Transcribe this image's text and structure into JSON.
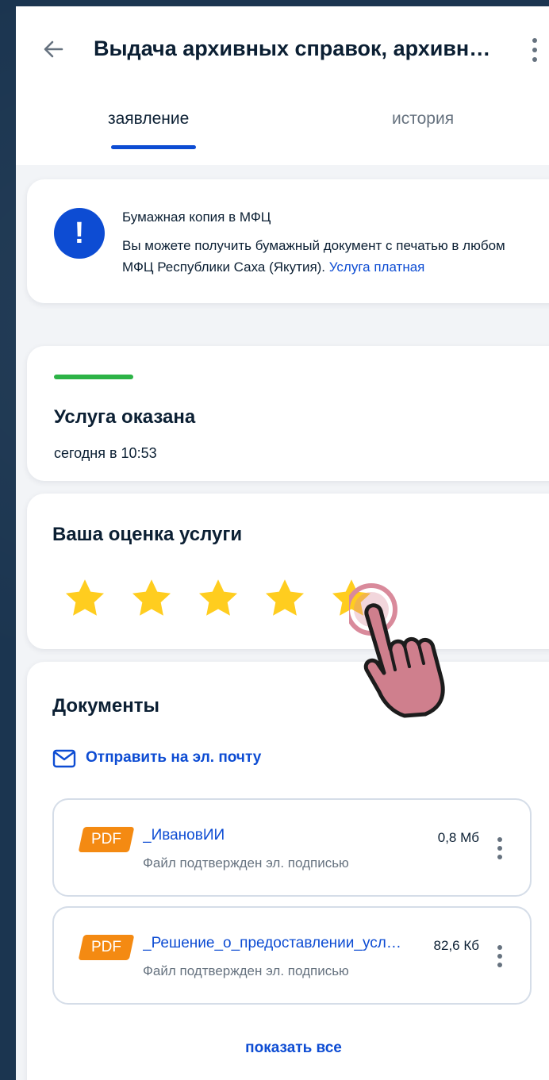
{
  "header": {
    "title": "Выдача архивных справок, архивных выписок и копий архивных документов"
  },
  "tabs": [
    {
      "label": "заявление",
      "active": true
    },
    {
      "label": "история",
      "active": false
    }
  ],
  "info": {
    "icon": "exclamation-icon",
    "title": "Бумажная копия в МФЦ",
    "text": "Вы можете получить бумажный документ с печатью в любом МФЦ Республики Саха (Якутия).",
    "link": "Услуга платная"
  },
  "status": {
    "title": "Услуга оказана",
    "time": "сегодня в 10:53",
    "color": "#2cb346"
  },
  "rating": {
    "title": "Ваша оценка услуги",
    "value": 5,
    "max": 5,
    "star_color": "#ffcd1f"
  },
  "documents": {
    "title": "Документы",
    "email_link": "Отправить на эл. почту",
    "items": [
      {
        "type": "PDF",
        "name": "_ИвановИИ",
        "size": "0,8 Мб",
        "status": "Файл подтвержден эл. подписью"
      },
      {
        "type": "PDF",
        "name": "_Решение_о_предоставлении_услуги",
        "size": "82,6 Кб",
        "status": "Файл подтвержден эл. подписью"
      }
    ],
    "show_all": "показать все"
  },
  "colors": {
    "accent": "#0d4cd3",
    "pdf": "#f48a12",
    "text": "#0b1f33",
    "secondary": "#66727f"
  },
  "overlay": {
    "icon": "tap-hand-icon"
  }
}
